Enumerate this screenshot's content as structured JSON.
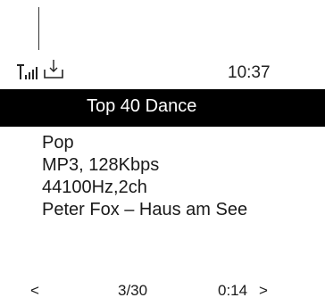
{
  "status": {
    "signal_icon": "signal-bars-icon",
    "download_icon": "download-icon",
    "time": "10:37"
  },
  "header": {
    "title": "Top 40 Dance"
  },
  "track_info": {
    "genre": "Pop",
    "format": "MP3, 128Kbps",
    "sample_rate": "44100Hz,2ch",
    "song": "Peter Fox – Haus am See"
  },
  "footer": {
    "prev_label": "<",
    "position": "3/30",
    "elapsed": "0:14",
    "next_label": ">"
  }
}
